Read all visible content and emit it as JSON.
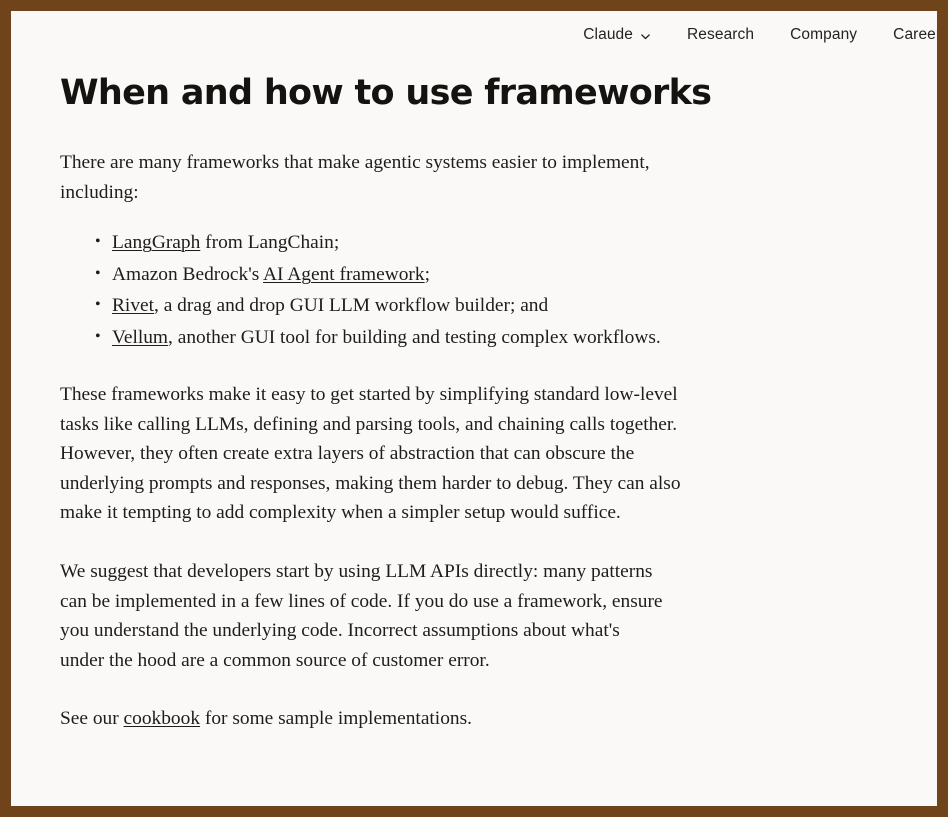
{
  "theme": {
    "border_color": "#70441a",
    "page_background": "#faf9f7",
    "text_color": "#1f1d1a",
    "title_color": "#15130f"
  },
  "nav": {
    "items": [
      {
        "label": "Claude",
        "has_chevron": true,
        "icon": "chevron-down-icon"
      },
      {
        "label": "Research",
        "has_chevron": false
      },
      {
        "label": "Company",
        "has_chevron": false
      },
      {
        "label": "Careers",
        "has_chevron": false
      }
    ]
  },
  "article": {
    "title": "When and how to use frameworks",
    "intro": "There are many frameworks that make agentic systems easier to implement, including:",
    "frameworks": [
      {
        "link_text": "LangGraph",
        "link_position": "start",
        "rest": " from LangChain;"
      },
      {
        "prefix": "Amazon Bedrock's ",
        "link_text": "AI Agent framework",
        "link_position": "middle",
        "rest": ";"
      },
      {
        "link_text": "Rivet",
        "link_position": "start",
        "rest": ", a drag and drop GUI LLM workflow builder; and"
      },
      {
        "link_text": "Vellum",
        "link_position": "start",
        "rest": ", another GUI tool for building and testing complex workflows."
      }
    ],
    "paragraph_2": "These frameworks make it easy to get started by simplifying standard low-level tasks like calling LLMs, defining and parsing tools, and chaining calls together. However, they often create extra layers of abstraction that can obscure the underlying prompts and responses, making them harder to debug. They can also make it tempting to add complexity when a simpler setup would suffice.",
    "paragraph_3": "We suggest that developers start by using LLM APIs directly: many patterns can be implemented in a few lines of code. If you do use a framework, ensure you understand the underlying code. Incorrect assumptions about what's under the hood are a common source of customer error.",
    "closing": {
      "before_link": "See our ",
      "link_text": "cookbook",
      "after_link": " for some sample implementations."
    }
  }
}
